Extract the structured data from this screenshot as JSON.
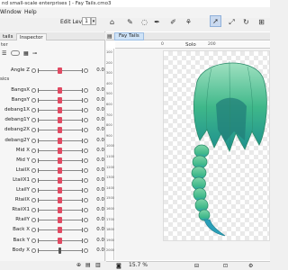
{
  "window": {
    "title": "nd small-scale enterprises ] - Fay Tails.cmo3"
  },
  "menu": {
    "items": [
      "Window",
      "Help"
    ]
  },
  "toolbar": {
    "edit_level_label": "Edit Level",
    "edit_level_value": "1"
  },
  "left_panel": {
    "tabs": [
      "tails",
      "Inspector"
    ],
    "active_tab": "Inspector",
    "subheader": "ter",
    "group_header": "sics",
    "top_param": {
      "label": "Angle Z",
      "value": "0.0"
    },
    "params": [
      {
        "label": "BangsX",
        "value": "0.0"
      },
      {
        "label": "BangsY",
        "value": "0.0"
      },
      {
        "label": "debang1X",
        "value": "0.0"
      },
      {
        "label": "debang1Y",
        "value": "0.0"
      },
      {
        "label": "debang2X",
        "value": "0.0"
      },
      {
        "label": "debang2Y",
        "value": "0.0"
      },
      {
        "label": "Mid X",
        "value": "0.0"
      },
      {
        "label": "Mid Y",
        "value": "0.0"
      },
      {
        "label": "LtailX",
        "value": "0.0"
      },
      {
        "label": "LtailX1",
        "value": "0.0"
      },
      {
        "label": "LtailY",
        "value": "0.0"
      },
      {
        "label": "RtailX",
        "value": "0.0"
      },
      {
        "label": "RtailX1",
        "value": "0.0"
      },
      {
        "label": "RtailY",
        "value": "0.0"
      },
      {
        "label": "Back X",
        "value": "0.0"
      },
      {
        "label": "Back Y",
        "value": "0.0"
      },
      {
        "label": "Body X",
        "value": "0.0"
      }
    ]
  },
  "canvas": {
    "doc_tab": "Fay Tails",
    "solo_label": "Solo",
    "ruler_top": [
      "0",
      "200"
    ],
    "ruler_left": [
      "100",
      "200",
      "300",
      "400",
      "500",
      "600",
      "700",
      "800",
      "900",
      "1000",
      "1100",
      "1200",
      "1300",
      "1400",
      "1500",
      "1600",
      "1700",
      "1800",
      "1900",
      "2000"
    ],
    "zoom": "15.7 %"
  },
  "colors": {
    "knob": "#e04a62",
    "hair_light": "#9fe0c0",
    "hair_mid": "#3fb88a",
    "hair_dark": "#1d8f8f",
    "hair_tip": "#2a9fb8"
  },
  "icons": [
    "home-icon",
    "cursor-icon",
    "lasso-icon",
    "select-icon",
    "pen-icon",
    "bone-icon",
    "camera-icon"
  ]
}
